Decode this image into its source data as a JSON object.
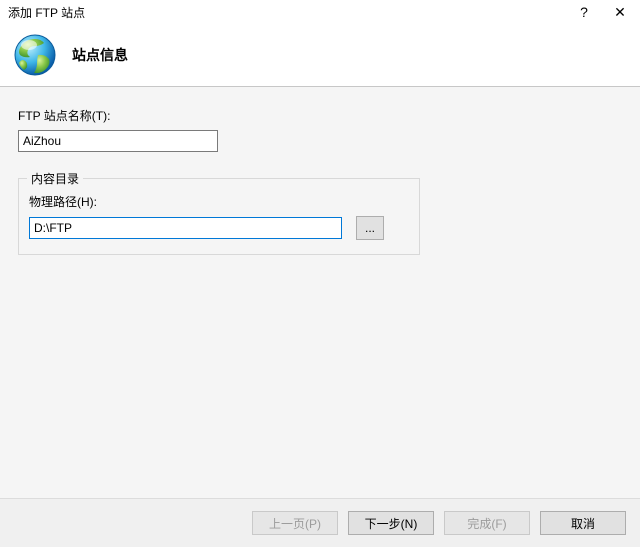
{
  "window": {
    "title": "添加 FTP 站点",
    "help_glyph": "?",
    "close_glyph": "✕"
  },
  "header": {
    "title": "站点信息"
  },
  "site_name": {
    "label": "FTP 站点名称(T):",
    "value": "AiZhou"
  },
  "content_dir": {
    "legend": "内容目录",
    "path_label": "物理路径(H):",
    "path_value": "D:\\FTP",
    "browse_label": "..."
  },
  "footer": {
    "prev": "上一页(P)",
    "next": "下一步(N)",
    "finish": "完成(F)",
    "cancel": "取消"
  }
}
